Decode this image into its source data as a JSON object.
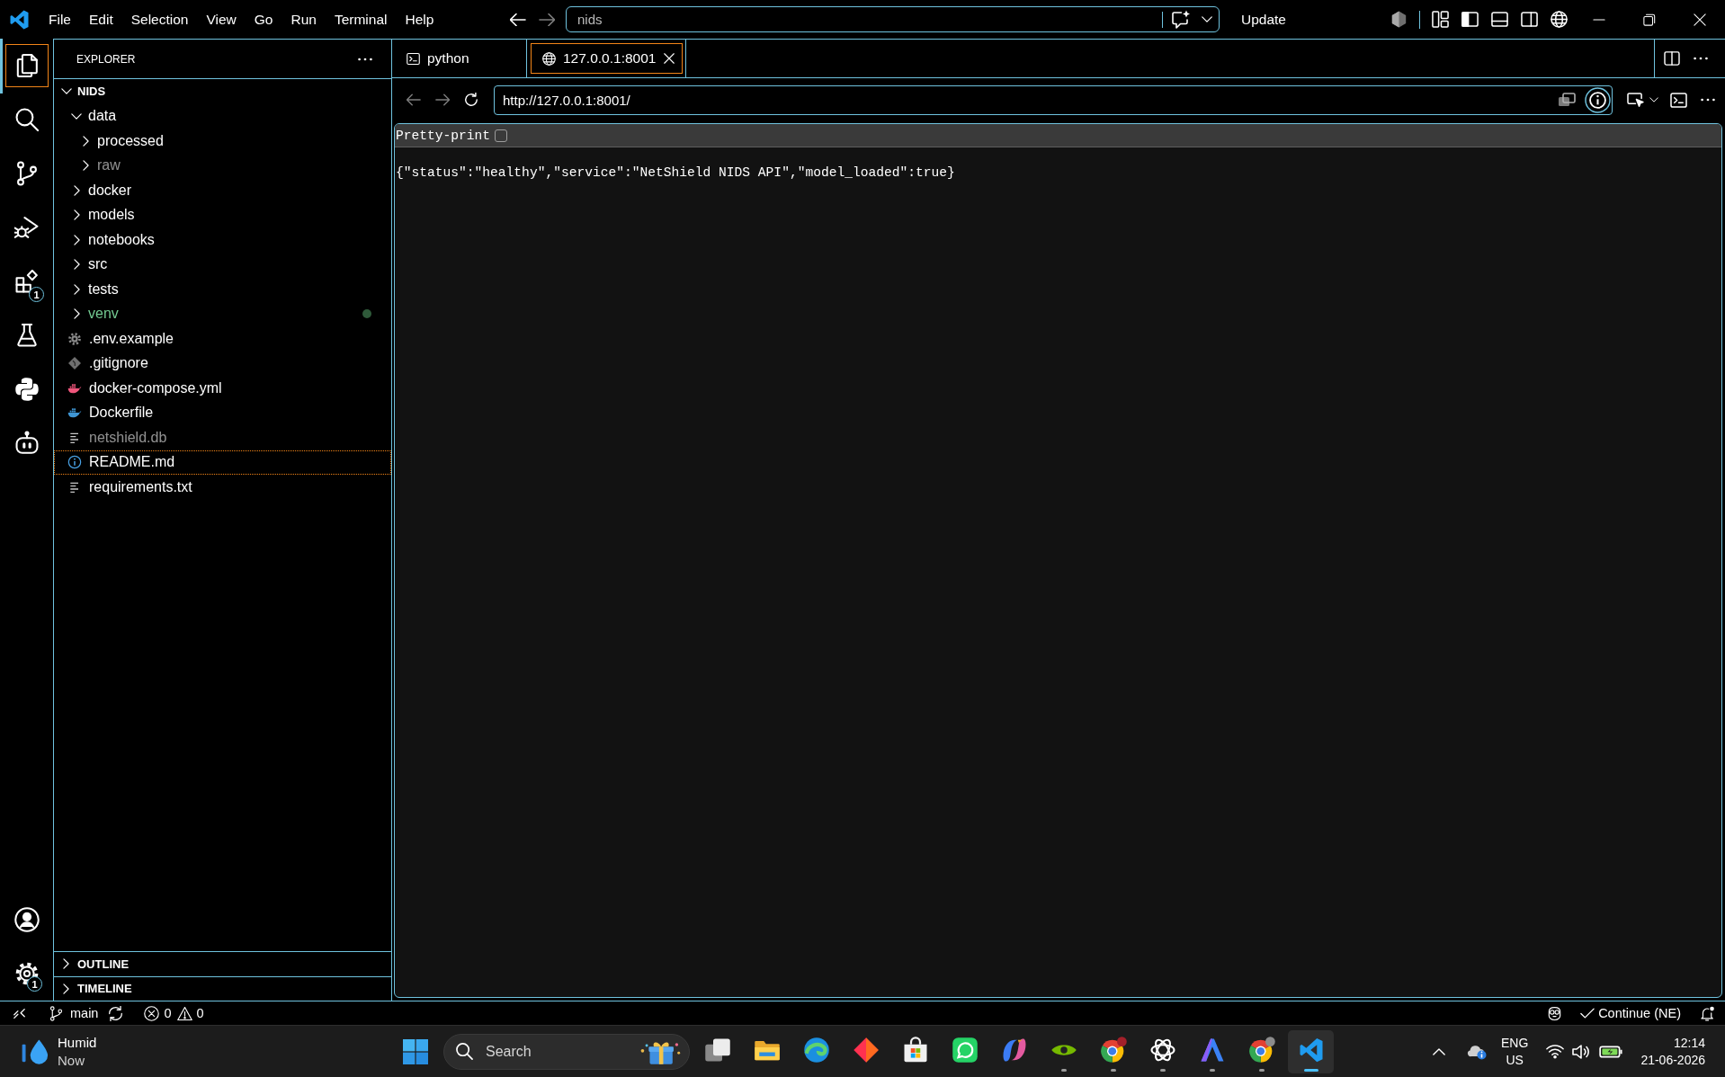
{
  "title_bar": {
    "menu": [
      "File",
      "Edit",
      "Selection",
      "View",
      "Go",
      "Run",
      "Terminal",
      "Help"
    ],
    "back": {
      "disabled": false
    },
    "forward": {
      "disabled": true
    },
    "command_center": "nids",
    "update_button": "Update",
    "layout_toggles": [
      {
        "kind": "primary-sidebar",
        "on": true
      },
      {
        "kind": "panel",
        "on": false
      },
      {
        "kind": "secondary-sidebar",
        "on": false
      }
    ]
  },
  "activity_bar": {
    "items": [
      {
        "kind": "explorer",
        "selected": true
      },
      {
        "kind": "search",
        "selected": false
      },
      {
        "kind": "source-control",
        "selected": false
      },
      {
        "kind": "run-debug",
        "selected": false
      },
      {
        "kind": "extensions",
        "selected": false,
        "badge": "1"
      },
      {
        "kind": "testing",
        "selected": false
      },
      {
        "kind": "python",
        "selected": false
      },
      {
        "kind": "chat",
        "selected": false
      }
    ],
    "bottom": [
      {
        "kind": "account"
      },
      {
        "kind": "settings",
        "badge": "1"
      }
    ]
  },
  "explorer": {
    "title": "EXPLORER",
    "root": {
      "label": "NIDS",
      "expanded": true,
      "children": [
        {
          "kind": "folder",
          "label": "data",
          "expanded": true,
          "ignored": false,
          "untracked": false,
          "selected": false,
          "children": [
            {
              "kind": "folder",
              "label": "processed",
              "expanded": false,
              "ignored": false,
              "untracked": false,
              "selected": false
            },
            {
              "kind": "folder",
              "label": "raw",
              "expanded": false,
              "ignored": true,
              "untracked": false,
              "selected": false
            }
          ]
        },
        {
          "kind": "folder",
          "label": "docker",
          "expanded": false,
          "ignored": false,
          "untracked": false,
          "selected": false
        },
        {
          "kind": "folder",
          "label": "models",
          "expanded": false,
          "ignored": false,
          "untracked": false,
          "selected": false
        },
        {
          "kind": "folder",
          "label": "notebooks",
          "expanded": false,
          "ignored": false,
          "untracked": false,
          "selected": false
        },
        {
          "kind": "folder",
          "label": "src",
          "expanded": false,
          "ignored": false,
          "untracked": false,
          "selected": false
        },
        {
          "kind": "folder",
          "label": "tests",
          "expanded": false,
          "ignored": false,
          "untracked": false,
          "selected": false
        },
        {
          "kind": "folder",
          "label": "venv",
          "expanded": false,
          "ignored": false,
          "untracked": true,
          "selected": false
        },
        {
          "kind": "config-file",
          "label": ".env.example",
          "ignored": false,
          "untracked": false,
          "selected": false
        },
        {
          "kind": "git-file",
          "label": ".gitignore",
          "ignored": false,
          "untracked": false,
          "selected": false
        },
        {
          "kind": "compose-file",
          "label": "docker-compose.yml",
          "ignored": false,
          "untracked": false,
          "selected": false
        },
        {
          "kind": "docker-file",
          "label": "Dockerfile",
          "ignored": false,
          "untracked": false,
          "selected": false
        },
        {
          "kind": "text-file",
          "label": "netshield.db",
          "ignored": true,
          "untracked": false,
          "selected": false
        },
        {
          "kind": "info-file",
          "label": "README.md",
          "ignored": false,
          "untracked": false,
          "selected": true
        },
        {
          "kind": "text-file",
          "label": "requirements.txt",
          "ignored": false,
          "untracked": false,
          "selected": false
        }
      ]
    },
    "sections": [
      {
        "label": "OUTLINE",
        "expanded": false
      },
      {
        "label": "TIMELINE",
        "expanded": false
      }
    ]
  },
  "editor": {
    "tabs": [
      {
        "kind": "terminal",
        "label": "python",
        "selected": false
      },
      {
        "kind": "browser",
        "label": "127.0.0.1:8001",
        "selected": true
      }
    ],
    "browser": {
      "back": {
        "disabled": true
      },
      "forward": {
        "disabled": true
      },
      "url": "http://127.0.0.1:8001/",
      "pretty_print": {
        "label": "Pretty-print",
        "checked": false
      },
      "body": "{\"status\":\"healthy\",\"service\":\"NetShield NIDS API\",\"model_loaded\":true}"
    }
  },
  "status_bar": {
    "branch": "main",
    "errors": "0",
    "warnings": "0",
    "continue_label": "Continue (NE)"
  },
  "taskbar": {
    "weather": {
      "condition": "Humid",
      "time": "Now"
    },
    "search": {
      "placeholder": "Search"
    },
    "apps": [
      {
        "kind": "task-view",
        "running": false,
        "selected": false
      },
      {
        "kind": "folder",
        "running": false,
        "selected": false
      },
      {
        "kind": "swirl",
        "running": false,
        "selected": false
      },
      {
        "kind": "diamond",
        "running": false,
        "selected": false
      },
      {
        "kind": "bag",
        "running": false,
        "selected": false
      },
      {
        "kind": "phone-chat",
        "running": false,
        "selected": false
      },
      {
        "kind": "loop",
        "running": false,
        "selected": false
      },
      {
        "kind": "eye",
        "running": true,
        "selected": false
      },
      {
        "kind": "badged-wheel",
        "running": true,
        "selected": false
      },
      {
        "kind": "knot",
        "running": true,
        "selected": false
      },
      {
        "kind": "peak",
        "running": true,
        "selected": false
      },
      {
        "kind": "avatar-wheel",
        "running": true,
        "selected": false
      },
      {
        "kind": "code",
        "running": true,
        "selected": true
      }
    ],
    "tray": {
      "language": "ENG",
      "region": "US",
      "time": "12:14",
      "date": "21-06-2026"
    }
  }
}
